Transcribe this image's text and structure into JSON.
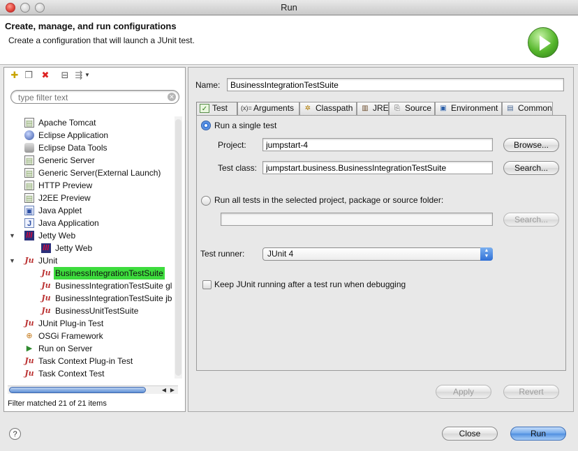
{
  "window": {
    "title": "Run"
  },
  "header": {
    "title": "Create, manage, and run configurations",
    "description": "Create a configuration that will launch a JUnit test."
  },
  "left_panel": {
    "filter": {
      "placeholder": "type filter text"
    },
    "status": "Filter matched 21 of 21 items",
    "tree": [
      {
        "label": "Apache Tomcat",
        "icon": "launch-config-icon",
        "level": 0
      },
      {
        "label": "Eclipse Application",
        "icon": "eclipse-icon",
        "level": 0
      },
      {
        "label": "Eclipse Data Tools",
        "icon": "database-icon",
        "level": 0
      },
      {
        "label": "Generic Server",
        "icon": "launch-config-icon",
        "level": 0
      },
      {
        "label": "Generic Server(External Launch)",
        "icon": "launch-config-icon",
        "level": 0
      },
      {
        "label": "HTTP Preview",
        "icon": "launch-config-icon",
        "level": 0
      },
      {
        "label": "J2EE Preview",
        "icon": "launch-config-icon",
        "level": 0
      },
      {
        "label": "Java Applet",
        "icon": "java-applet-icon",
        "level": 0
      },
      {
        "label": "Java Application",
        "icon": "java-application-icon",
        "level": 0
      },
      {
        "label": "Jetty Web",
        "icon": "jetty-icon",
        "level": 0,
        "expanded": true
      },
      {
        "label": "Jetty Web",
        "icon": "jetty-icon",
        "level": 1
      },
      {
        "label": "JUnit",
        "icon": "junit-icon",
        "level": 0,
        "expanded": true
      },
      {
        "label": "BusinessIntegrationTestSuite",
        "icon": "junit-icon",
        "level": 1,
        "selected": true
      },
      {
        "label": "BusinessIntegrationTestSuite gl",
        "icon": "junit-icon",
        "level": 1
      },
      {
        "label": "BusinessIntegrationTestSuite jbo",
        "icon": "junit-icon",
        "level": 1
      },
      {
        "label": "BusinessUnitTestSuite",
        "icon": "junit-icon",
        "level": 1
      },
      {
        "label": "JUnit Plug-in Test",
        "icon": "junit-plugin-icon",
        "level": 0
      },
      {
        "label": "OSGi Framework",
        "icon": "osgi-icon",
        "level": 0
      },
      {
        "label": "Run on Server",
        "icon": "server-icon",
        "level": 0
      },
      {
        "label": "Task Context Plug-in Test",
        "icon": "junit-plugin-icon",
        "level": 0
      },
      {
        "label": "Task Context Test",
        "icon": "junit-plugin-icon",
        "level": 0
      }
    ]
  },
  "right_panel": {
    "name_label": "Name:",
    "name_value": "BusinessIntegrationTestSuite",
    "tabs": [
      {
        "label": "Test",
        "icon": "test-tab-icon",
        "active": true
      },
      {
        "label": "Arguments",
        "icon": "arguments-icon"
      },
      {
        "label": "Classpath",
        "icon": "classpath-icon"
      },
      {
        "label": "JRE",
        "icon": "jre-icon"
      },
      {
        "label": "Source",
        "icon": "source-icon"
      },
      {
        "label": "Environment",
        "icon": "environment-icon"
      },
      {
        "label": "Common",
        "icon": "common-icon"
      }
    ],
    "test_tab": {
      "single_test_label": "Run a single test",
      "project_label": "Project:",
      "project_value": "jumpstart-4",
      "browse_label": "Browse...",
      "test_class_label": "Test class:",
      "test_class_value": "jumpstart.business.BusinessIntegrationTestSuite",
      "search_label": "Search...",
      "run_all_label": "Run all tests in the selected project, package or source folder:",
      "run_all_value": "",
      "search2_label": "Search...",
      "test_runner_label": "Test runner:",
      "test_runner_value": "JUnit 4",
      "keep_running_label": "Keep JUnit running after a test run when debugging",
      "keep_running_checked": false,
      "single_test_selected": true
    },
    "apply_label": "Apply",
    "revert_label": "Revert"
  },
  "footer": {
    "close_label": "Close",
    "run_label": "Run",
    "help_symbol": "?"
  }
}
